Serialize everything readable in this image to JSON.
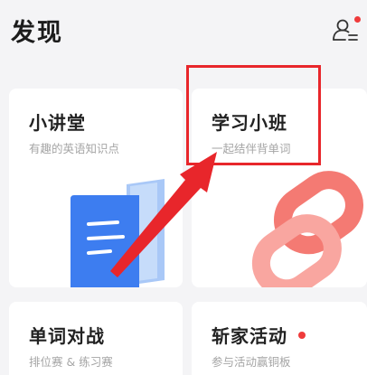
{
  "header": {
    "title": "发现",
    "profile_icon": "person-settings-icon",
    "notification_color": "#ef3b3b"
  },
  "cards": {
    "lecture": {
      "title": "小讲堂",
      "subtitle": "有趣的英语知识点",
      "icon": "document-icon"
    },
    "study_class": {
      "title": "学习小班",
      "subtitle": "一起结伴背单词",
      "icon": "chain-link-icon"
    },
    "word_battle": {
      "title": "单词对战",
      "subtitle": "排位赛 & 练习赛"
    },
    "event": {
      "title": "斩家活动",
      "subtitle": "参与活动赢铜板",
      "badge_color": "#ef3b3b"
    }
  },
  "annotation": {
    "color": "#e8262b"
  }
}
